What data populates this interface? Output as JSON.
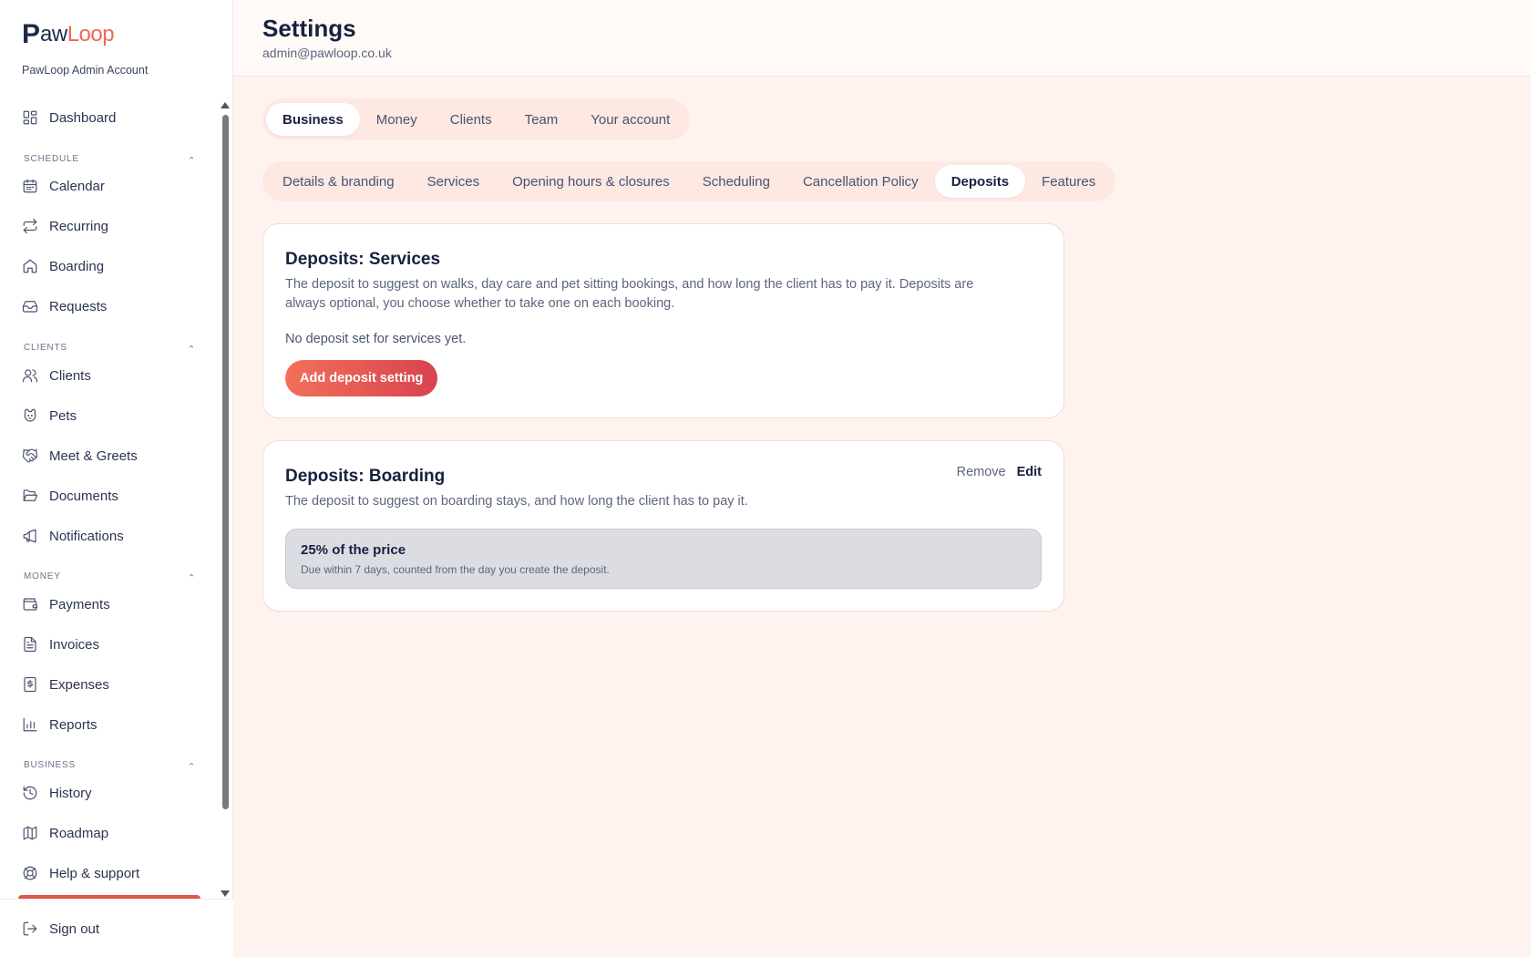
{
  "brand": {
    "logo_p": "P",
    "logo_paw": "aw",
    "logo_loop": "Loop",
    "account_name": "PawLoop Admin Account"
  },
  "sidebar": {
    "dashboard": "Dashboard",
    "sections": {
      "schedule": "SCHEDULE",
      "clients": "CLIENTS",
      "money": "MONEY",
      "business": "BUSINESS"
    },
    "items": {
      "calendar": "Calendar",
      "recurring": "Recurring",
      "boarding": "Boarding",
      "requests": "Requests",
      "clients": "Clients",
      "pets": "Pets",
      "meet_greets": "Meet & Greets",
      "documents": "Documents",
      "notifications": "Notifications",
      "payments": "Payments",
      "invoices": "Invoices",
      "expenses": "Expenses",
      "reports": "Reports",
      "history": "History",
      "roadmap": "Roadmap",
      "help": "Help & support"
    },
    "sign_out": "Sign out"
  },
  "header": {
    "title": "Settings",
    "email": "admin@pawloop.co.uk"
  },
  "tabs_primary": [
    "Business",
    "Money",
    "Clients",
    "Team",
    "Your account"
  ],
  "tabs_primary_active": "Business",
  "tabs_secondary": [
    "Details & branding",
    "Services",
    "Opening hours & closures",
    "Scheduling",
    "Cancellation Policy",
    "Deposits",
    "Features"
  ],
  "tabs_secondary_active": "Deposits",
  "services_card": {
    "title": "Deposits: Services",
    "description": "The deposit to suggest on walks, day care and pet sitting bookings, and how long the client has to pay it. Deposits are always optional, you choose whether to take one on each booking.",
    "empty": "No deposit set for services yet.",
    "button": "Add deposit setting"
  },
  "boarding_card": {
    "title": "Deposits: Boarding",
    "description": "The deposit to suggest on boarding stays, and how long the client has to pay it.",
    "remove": "Remove",
    "edit": "Edit",
    "deposit_title": "25% of the price",
    "deposit_sub": "Due within 7 days, counted from the day you create the deposit."
  },
  "colors": {
    "accent": "#ec6a55",
    "button_start": "#f2705a",
    "button_end": "#d8434f",
    "bg": "#fff3ef",
    "tab_bg": "#fde8e2"
  }
}
